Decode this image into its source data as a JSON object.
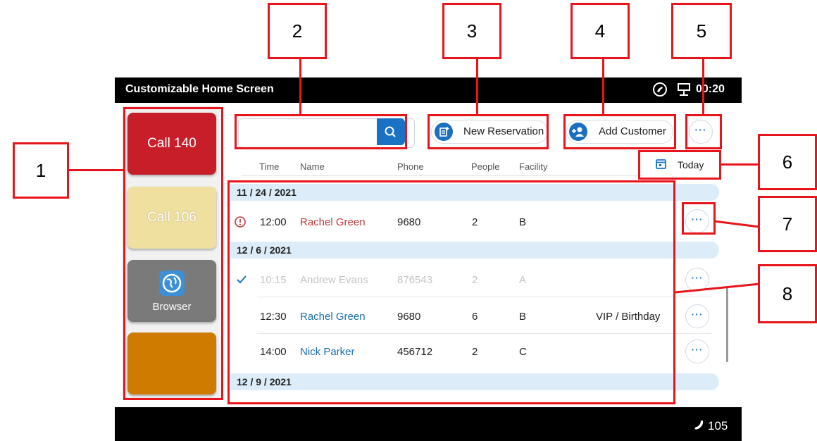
{
  "status_bar": {
    "title": "Customizable Home Screen",
    "time": "00:20"
  },
  "bottom_bar": {
    "extension": "105"
  },
  "left_panel": {
    "tiles": [
      {
        "label": "Call 140",
        "color": "#c71e2a"
      },
      {
        "label": "Call 106",
        "color": "#efe0a0"
      },
      {
        "label": "Browser",
        "color": "#7a7a7a"
      },
      {
        "label": "",
        "color": "#cf7b00"
      }
    ]
  },
  "toolbar": {
    "search_placeholder": "",
    "new_reservation_label": "New Reservation",
    "add_customer_label": "Add Customer",
    "today_label": "Today"
  },
  "table": {
    "columns": [
      "Time",
      "Name",
      "Phone",
      "People",
      "Facility"
    ],
    "groups": [
      {
        "date": "11 / 24 / 2021",
        "rows": [
          {
            "status": "alert",
            "time": "12:00",
            "name": "Rachel Green",
            "phone": "9680",
            "people": "2",
            "facility": "B",
            "note": ""
          }
        ]
      },
      {
        "date": "12 / 6 / 2021",
        "rows": [
          {
            "status": "done",
            "time": "10:15",
            "name": "Andrew Evans",
            "phone": "876543",
            "people": "2",
            "facility": "A",
            "note": ""
          },
          {
            "status": "",
            "time": "12:30",
            "name": "Rachel Green",
            "phone": "9680",
            "people": "6",
            "facility": "B",
            "note": "VIP / Birthday"
          },
          {
            "status": "",
            "time": "14:00",
            "name": "Nick Parker",
            "phone": "456712",
            "people": "2",
            "facility": "C",
            "note": ""
          }
        ]
      },
      {
        "date": "12 / 9 / 2021",
        "rows": []
      }
    ]
  },
  "callouts": [
    "1",
    "2",
    "3",
    "4",
    "5",
    "6",
    "7",
    "8"
  ],
  "colors": {
    "accent": "#1a72c4",
    "callout_red": "#e8141b",
    "alert_red": "#c0393b",
    "name_blue": "#1a6fb0"
  }
}
